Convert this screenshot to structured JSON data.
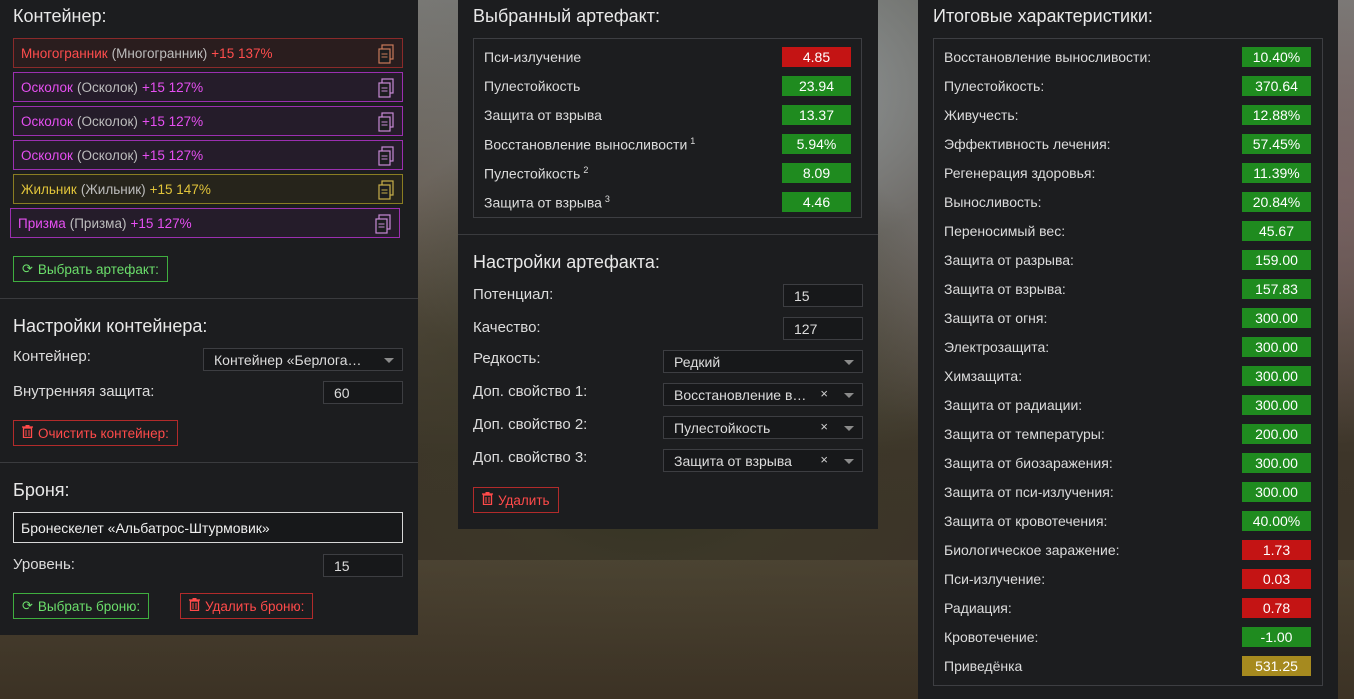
{
  "container_panel": {
    "title": "Контейнер:",
    "items": [
      {
        "name": "Многогранник",
        "orig": "(Многогранник)",
        "level": "+15 137%",
        "rarity": "red"
      },
      {
        "name": "Осколок",
        "orig": "(Осколок)",
        "level": "+15 127%",
        "rarity": "purple"
      },
      {
        "name": "Осколок",
        "orig": "(Осколок)",
        "level": "+15 127%",
        "rarity": "purple"
      },
      {
        "name": "Осколок",
        "orig": "(Осколок)",
        "level": "+15 127%",
        "rarity": "purple"
      },
      {
        "name": "Жильник",
        "orig": "(Жильник)",
        "level": "+15 147%",
        "rarity": "yellow"
      },
      {
        "name": "Призма",
        "orig": "(Призма)",
        "level": "+15 127%",
        "rarity": "purple"
      }
    ],
    "select_artifact_button": "Выбрать артефакт:"
  },
  "container_settings": {
    "title": "Настройки контейнера:",
    "container_label": "Контейнер:",
    "container_value": "Контейнер «Берлога…",
    "inner_protection_label": "Внутренняя защита:",
    "inner_protection_value": "60",
    "clear_button": "Очистить контейнер:"
  },
  "armor": {
    "title": "Броня:",
    "name": "Бронескелет «Альбатрос-Штурмовик»",
    "level_label": "Уровень:",
    "level_value": "15",
    "select_button": "Выбрать броню:",
    "delete_button": "Удалить броню:"
  },
  "selected_artifact": {
    "title": "Выбранный артефакт:",
    "stats": [
      {
        "name": "Пси-излучение",
        "sup": "",
        "value": "4.85",
        "color": "red"
      },
      {
        "name": "Пулестойкость",
        "sup": "",
        "value": "23.94",
        "color": "green"
      },
      {
        "name": "Защита от взрыва",
        "sup": "",
        "value": "13.37",
        "color": "green"
      },
      {
        "name": "Восстановление выносливости",
        "sup": "1",
        "value": "5.94%",
        "color": "green"
      },
      {
        "name": "Пулестойкость",
        "sup": "2",
        "value": "8.09",
        "color": "green"
      },
      {
        "name": "Защита от взрыва",
        "sup": "3",
        "value": "4.46",
        "color": "green"
      }
    ]
  },
  "artifact_settings": {
    "title": "Настройки артефакта:",
    "potential_label": "Потенциал:",
    "potential_value": "15",
    "quality_label": "Качество:",
    "quality_value": "127",
    "rarity_label": "Редкость:",
    "rarity_value": "Редкий",
    "prop1_label": "Доп. свойство 1:",
    "prop1_value": "Восстановление в…",
    "prop2_label": "Доп. свойство 2:",
    "prop2_value": "Пулестойкость",
    "prop3_label": "Доп. свойство 3:",
    "prop3_value": "Защита от взрыва",
    "clear_x": "×",
    "delete_button": "Удалить"
  },
  "totals": {
    "title": "Итоговые характеристики:",
    "stats": [
      {
        "name": "Восстановление выносливости:",
        "value": "10.40%",
        "color": "green"
      },
      {
        "name": "Пулестойкость:",
        "value": "370.64",
        "color": "green"
      },
      {
        "name": "Живучесть:",
        "value": "12.88%",
        "color": "green"
      },
      {
        "name": "Эффективность лечения:",
        "value": "57.45%",
        "color": "green"
      },
      {
        "name": "Регенерация здоровья:",
        "value": "11.39%",
        "color": "green"
      },
      {
        "name": "Выносливость:",
        "value": "20.84%",
        "color": "green"
      },
      {
        "name": "Переносимый вес:",
        "value": "45.67",
        "color": "green"
      },
      {
        "name": "Защита от разрыва:",
        "value": "159.00",
        "color": "green"
      },
      {
        "name": "Защита от взрыва:",
        "value": "157.83",
        "color": "green"
      },
      {
        "name": "Защита от огня:",
        "value": "300.00",
        "color": "green"
      },
      {
        "name": "Электрозащита:",
        "value": "300.00",
        "color": "green"
      },
      {
        "name": "Химзащита:",
        "value": "300.00",
        "color": "green"
      },
      {
        "name": "Защита от радиации:",
        "value": "300.00",
        "color": "green"
      },
      {
        "name": "Защита от температуры:",
        "value": "200.00",
        "color": "green"
      },
      {
        "name": "Защита от биозаражения:",
        "value": "300.00",
        "color": "green"
      },
      {
        "name": "Защита от пси-излучения:",
        "value": "300.00",
        "color": "green"
      },
      {
        "name": "Защита от кровотечения:",
        "value": "40.00%",
        "color": "green"
      },
      {
        "name": "Биологическое заражение:",
        "value": "1.73",
        "color": "red"
      },
      {
        "name": "Пси-излучение:",
        "value": "0.03",
        "color": "red"
      },
      {
        "name": "Радиация:",
        "value": "0.78",
        "color": "red"
      },
      {
        "name": "Кровотечение:",
        "value": "-1.00",
        "color": "green"
      },
      {
        "name": "Приведёнка",
        "value": "531.25",
        "color": "yellow"
      }
    ]
  },
  "icons": {
    "copy": "copy-icon",
    "refresh": "refresh-icon",
    "trash": "trash-icon",
    "chevron": "chevron-down-icon"
  },
  "colors": {
    "green": "#1f8b1f",
    "red": "#c41414",
    "yellow": "#a68a1f",
    "panel": "#1c1d1f"
  }
}
